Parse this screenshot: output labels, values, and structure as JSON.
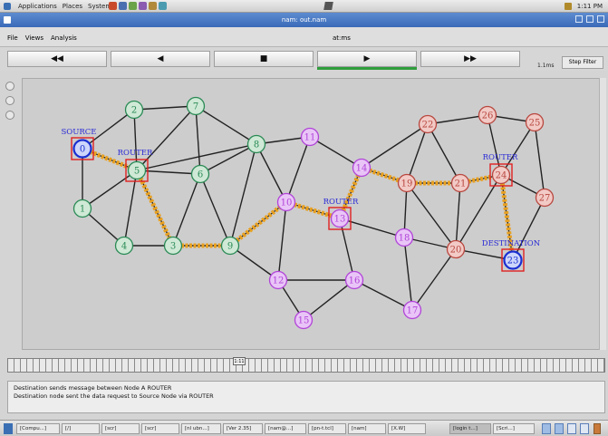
{
  "system_panel": {
    "menus": [
      "Applications",
      "Places",
      "System"
    ],
    "clock": "1:11 PM"
  },
  "window": {
    "title": "nam: out.nam"
  },
  "menu_bar": {
    "items": [
      "File",
      "Views",
      "Analysis"
    ],
    "time_label": "at:ms"
  },
  "controls": {
    "rewind": "◀◀",
    "back": "◀",
    "stop": "■",
    "play": "▶",
    "fast_forward": "▶▶",
    "speed": "1.1ms",
    "step_filter": "Step Filter"
  },
  "network": {
    "node_labels": {
      "0": "0",
      "1": "1",
      "2": "2",
      "3": "3",
      "4": "4",
      "5": "5",
      "6": "6",
      "7": "7",
      "8": "8",
      "9": "9",
      "10": "10",
      "11": "11",
      "12": "12",
      "13": "13",
      "14": "14",
      "15": "15",
      "16": "16",
      "17": "17",
      "18": "18",
      "19": "19",
      "20": "20",
      "21": "21",
      "22": "22",
      "23": "23",
      "24": "24",
      "25": "25",
      "26": "26",
      "27": "27"
    },
    "annotations": {
      "source": "SOURCE",
      "router1": "ROUTER",
      "router2": "ROUTER",
      "router3": "ROUTER",
      "destination": "DESTINATION"
    },
    "colors": {
      "green_group": "#2a8a55",
      "purple_group": "#b144d8",
      "red_group": "#b8473f",
      "endpoint": "#1a2fd1",
      "route": "#e8a020",
      "router_box": "#e02020",
      "label": "#2a2ad6"
    }
  },
  "timeline": {
    "handle_label": "1:11"
  },
  "messages": {
    "line1": "Destination sends message between Node A ROUTER",
    "line2": "Destination node sent the data request to Source Node via ROUTER"
  },
  "taskbar": {
    "items": [
      "[Compu...]",
      "[/]",
      "[scr]",
      "[scr]",
      "[nl ubn...]",
      "[Ver 2.35]",
      "[nam@...]",
      "[pn-t.tcl]",
      "[nam]",
      "[X.W]",
      "[login t...]",
      "[Scri...]"
    ]
  }
}
